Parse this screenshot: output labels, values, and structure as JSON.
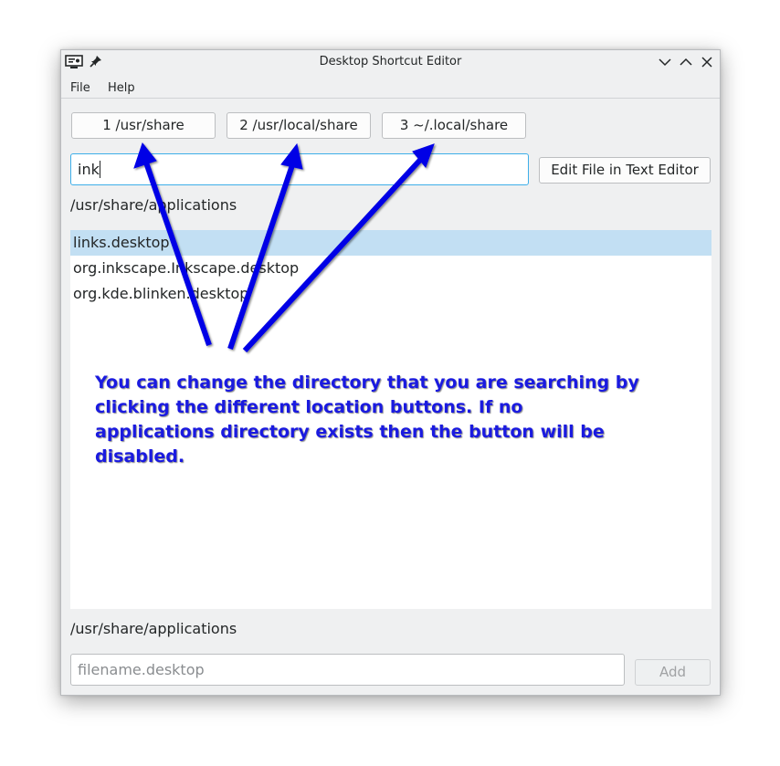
{
  "window": {
    "title": "Desktop Shortcut Editor",
    "icons": {
      "app": "monitor-app-icon",
      "pin": "pin-icon",
      "minimize": "chevron-down-icon",
      "maximize": "chevron-up-icon",
      "close": "close-icon"
    }
  },
  "menu": {
    "file": "File",
    "help": "Help"
  },
  "locations": {
    "btn1": "1 /usr/share",
    "btn2": "2 /usr/local/share",
    "btn3": "3 ~/.local/share"
  },
  "search": {
    "value": "ink"
  },
  "edit_button": "Edit File in Text Editor",
  "current_dir": "/usr/share/applications",
  "results": [
    {
      "label": "links.desktop",
      "selected": true
    },
    {
      "label": "org.inkscape.Inkscape.desktop",
      "selected": false
    },
    {
      "label": "org.kde.blinken.desktop",
      "selected": false
    }
  ],
  "new_file": {
    "dir": "/usr/share/applications",
    "placeholder": "filename.desktop",
    "add_label": "Add"
  },
  "annotation": {
    "text": "You can change the directory that you are searching by clicking the different location buttons. If no applications directory exists then the button will be disabled.",
    "color": "#1a1ae0"
  },
  "colors": {
    "accent": "#3daee9",
    "selection": "#c2dff3",
    "arrow": "#0000e6"
  }
}
